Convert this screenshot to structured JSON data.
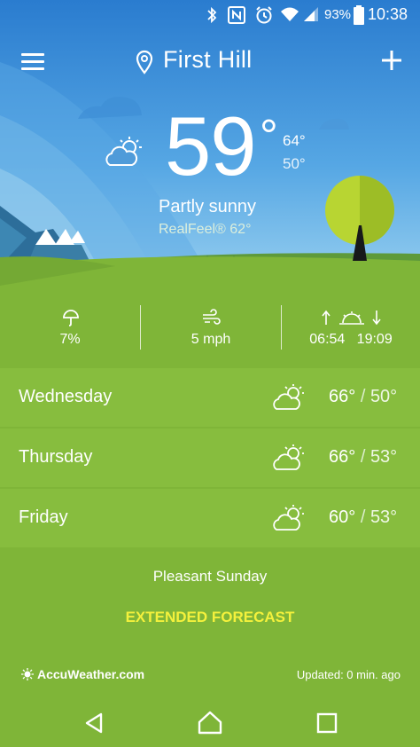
{
  "status_bar": {
    "battery_percent": "93%",
    "time": "10:38",
    "icons": [
      "bluetooth-icon",
      "nfc-icon",
      "alarm-icon",
      "wifi-icon",
      "cell-signal-icon",
      "battery-icon"
    ]
  },
  "app_bar": {
    "location": "First Hill",
    "menu_icon": "hamburger-menu-icon",
    "location_icon": "map-pin-icon",
    "add_icon": "plus-icon"
  },
  "current": {
    "temp": "59",
    "temp_unit": "°",
    "high": "64°",
    "low": "50°",
    "phrase": "Partly sunny",
    "realfeel": "RealFeel® 62°",
    "icon": "partly-sunny-icon"
  },
  "stats": {
    "precip": "7%",
    "precip_icon": "umbrella-icon",
    "wind": "5 mph",
    "wind_icon": "wind-icon",
    "sunrise": "06:54",
    "sunset": "19:09",
    "sun_icon": "sunrise-sunset-icon"
  },
  "forecast": [
    {
      "day": "Wednesday",
      "high": "66°",
      "low": "50°",
      "icon": "partly-sunny-icon"
    },
    {
      "day": "Thursday",
      "high": "66°",
      "low": "53°",
      "icon": "partly-sunny-icon"
    },
    {
      "day": "Friday",
      "high": "60°",
      "low": "53°",
      "icon": "partly-sunny-icon"
    }
  ],
  "headline": "Pleasant Sunday",
  "extended_forecast": "EXTENDED FORECAST",
  "footer": {
    "brand": "AccuWeather.com",
    "updated": "Updated: 0 min. ago"
  },
  "nav": {
    "back_icon": "back-triangle-icon",
    "home_icon": "home-icon",
    "recents_icon": "recents-square-icon"
  },
  "colors": {
    "sky_top": "#2b7fd0",
    "sky_bottom": "#8cc8ee",
    "grass": "#7fb538",
    "row_bg": "#87bd3e",
    "extended_accent": "#f4f13c"
  },
  "sep": "/"
}
